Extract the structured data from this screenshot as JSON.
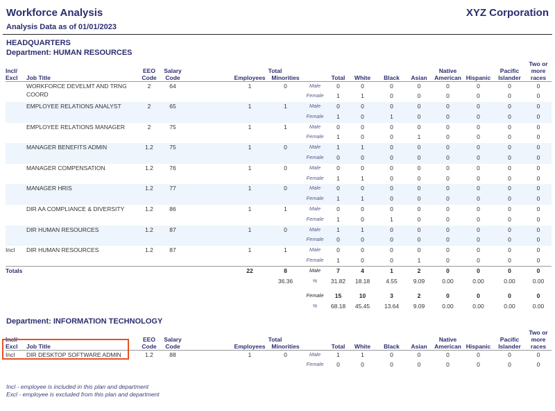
{
  "header": {
    "title": "Workforce Analysis",
    "company": "XYZ Corporation",
    "as_of": "Analysis Data as of 01/01/2023"
  },
  "location": "HEADQUARTERS",
  "columns": {
    "incl_excl_1": "Incl/",
    "incl_excl_2": "Excl",
    "job_title": "Job Title",
    "eeo_1": "EEO",
    "eeo_2": "Code",
    "salary_1": "Salary",
    "salary_2": "Code",
    "total_group": "Total",
    "employees": "Employees",
    "minorities": "Minorities",
    "total": "Total",
    "white": "White",
    "black": "Black",
    "asian": "Asian",
    "native_1": "Native",
    "native_2": "American",
    "hispanic": "Hispanic",
    "pacific_1": "Pacific",
    "pacific_2": "Islander",
    "two_1": "Two or",
    "two_2": "more",
    "two_3": "races"
  },
  "labels": {
    "male": "Male",
    "female": "Female",
    "pct": "%",
    "totals": "Totals"
  },
  "departments": [
    {
      "label": "Department:  HUMAN RESOURCES",
      "jobs": [
        {
          "incl": "",
          "title": "WORKFORCE DEVELMT AND TRNG COORD",
          "eeo": "2",
          "salary": "64",
          "employees": "1",
          "minorities": "0",
          "male": [
            "0",
            "0",
            "0",
            "0",
            "0",
            "0",
            "0",
            "0"
          ],
          "female": [
            "1",
            "1",
            "0",
            "0",
            "0",
            "0",
            "0",
            "0"
          ]
        },
        {
          "incl": "",
          "title": "EMPLOYEE RELATIONS ANALYST",
          "eeo": "2",
          "salary": "65",
          "employees": "1",
          "minorities": "1",
          "male": [
            "0",
            "0",
            "0",
            "0",
            "0",
            "0",
            "0",
            "0"
          ],
          "female": [
            "1",
            "0",
            "1",
            "0",
            "0",
            "0",
            "0",
            "0"
          ]
        },
        {
          "incl": "",
          "title": "EMPLOYEE RELATIONS MANAGER",
          "eeo": "2",
          "salary": "75",
          "employees": "1",
          "minorities": "1",
          "male": [
            "0",
            "0",
            "0",
            "0",
            "0",
            "0",
            "0",
            "0"
          ],
          "female": [
            "1",
            "0",
            "0",
            "1",
            "0",
            "0",
            "0",
            "0"
          ]
        },
        {
          "incl": "",
          "title": "MANAGER BENEFITS ADMIN",
          "eeo": "1.2",
          "salary": "75",
          "employees": "1",
          "minorities": "0",
          "male": [
            "1",
            "1",
            "0",
            "0",
            "0",
            "0",
            "0",
            "0"
          ],
          "female": [
            "0",
            "0",
            "0",
            "0",
            "0",
            "0",
            "0",
            "0"
          ]
        },
        {
          "incl": "",
          "title": "MANAGER COMPENSATION",
          "eeo": "1.2",
          "salary": "76",
          "employees": "1",
          "minorities": "0",
          "male": [
            "0",
            "0",
            "0",
            "0",
            "0",
            "0",
            "0",
            "0"
          ],
          "female": [
            "1",
            "1",
            "0",
            "0",
            "0",
            "0",
            "0",
            "0"
          ]
        },
        {
          "incl": "",
          "title": "MANAGER HRIS",
          "eeo": "1.2",
          "salary": "77",
          "employees": "1",
          "minorities": "0",
          "male": [
            "0",
            "0",
            "0",
            "0",
            "0",
            "0",
            "0",
            "0"
          ],
          "female": [
            "1",
            "1",
            "0",
            "0",
            "0",
            "0",
            "0",
            "0"
          ]
        },
        {
          "incl": "",
          "title": "DIR AA COMPLIANCE & DIVERSITY",
          "eeo": "1.2",
          "salary": "86",
          "employees": "1",
          "minorities": "1",
          "male": [
            "0",
            "0",
            "0",
            "0",
            "0",
            "0",
            "0",
            "0"
          ],
          "female": [
            "1",
            "0",
            "1",
            "0",
            "0",
            "0",
            "0",
            "0"
          ]
        },
        {
          "incl": "",
          "title": "DIR HUMAN RESOURCES",
          "eeo": "1.2",
          "salary": "87",
          "employees": "1",
          "minorities": "0",
          "male": [
            "1",
            "1",
            "0",
            "0",
            "0",
            "0",
            "0",
            "0"
          ],
          "female": [
            "0",
            "0",
            "0",
            "0",
            "0",
            "0",
            "0",
            "0"
          ]
        },
        {
          "incl": "Incl",
          "title": "DIR HUMAN RESOURCES",
          "eeo": "1.2",
          "salary": "87",
          "employees": "1",
          "minorities": "1",
          "male": [
            "0",
            "0",
            "0",
            "0",
            "0",
            "0",
            "0",
            "0"
          ],
          "female": [
            "1",
            "0",
            "0",
            "1",
            "0",
            "0",
            "0",
            "0"
          ]
        }
      ],
      "totals": {
        "employees": "22",
        "minorities": "8",
        "minorities_pct": "36.36",
        "male": [
          "7",
          "4",
          "1",
          "2",
          "0",
          "0",
          "0",
          "0"
        ],
        "male_pct": [
          "31.82",
          "18.18",
          "4.55",
          "9.09",
          "0.00",
          "0.00",
          "0.00",
          "0.00"
        ],
        "female": [
          "15",
          "10",
          "3",
          "2",
          "0",
          "0",
          "0",
          "0"
        ],
        "female_pct": [
          "68.18",
          "45.45",
          "13.64",
          "9.09",
          "0.00",
          "0.00",
          "0.00",
          "0.00"
        ]
      }
    },
    {
      "label": "Department:  INFORMATION TECHNOLOGY",
      "jobs": [
        {
          "incl": "Incl",
          "title": "DIR DESKTOP SOFTWARE ADMIN",
          "eeo": "1.2",
          "salary": "88",
          "employees": "1",
          "minorities": "0",
          "male": [
            "1",
            "1",
            "0",
            "0",
            "0",
            "0",
            "0",
            "0"
          ],
          "female": [
            "0",
            "0",
            "0",
            "0",
            "0",
            "0",
            "0",
            "0"
          ]
        }
      ]
    }
  ],
  "footnotes": [
    "Incl - employee is included in this plan and department",
    "Excl - employee is excluded from this plan and department"
  ],
  "highlight_color": "#e8501e"
}
